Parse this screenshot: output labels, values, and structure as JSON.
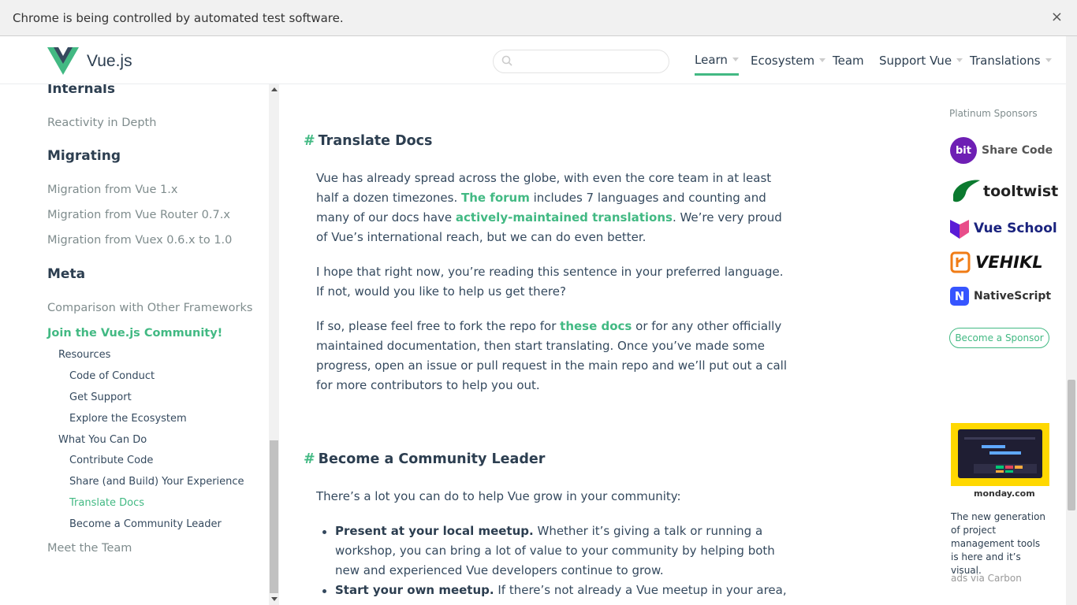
{
  "banner": {
    "text": "Chrome is being controlled by automated test software.",
    "close": "×"
  },
  "header": {
    "brand": "Vue.js",
    "search_placeholder": "",
    "nav": [
      "Learn",
      "Ecosystem",
      "Team",
      "Support Vue",
      "Translations"
    ]
  },
  "sidebar": {
    "internals": "Internals",
    "reactivity": "Reactivity in Depth",
    "migrating": "Migrating",
    "mig1": "Migration from Vue 1.x",
    "mig2": "Migration from Vue Router 0.7.x",
    "mig3": "Migration from Vuex 0.6.x to 1.0",
    "meta": "Meta",
    "comparison": "Comparison with Other Frameworks",
    "join": "Join the Vue.js Community!",
    "resources": "Resources",
    "coc": "Code of Conduct",
    "support": "Get Support",
    "explore": "Explore the Ecosystem",
    "whatyoucando": "What You Can Do",
    "contribute": "Contribute Code",
    "share": "Share (and Build) Your Experience",
    "translate": "Translate Docs",
    "leader": "Become a Community Leader",
    "team": "Meet the Team"
  },
  "content": {
    "hash": "#",
    "h_translate": "Translate Docs",
    "p1": {
      "a": "Vue has already spread across the globe, with even the core team in at least half a dozen timezones. ",
      "link1": "The forum",
      "b": " includes 7 languages and counting and many of our docs have ",
      "link2": "actively-maintained translations",
      "c": ". We’re very proud of Vue’s international reach, but we can do even better."
    },
    "p2": "I hope that right now, you’re reading this sentence in your preferred language. If not, would you like to help us get there?",
    "p3": {
      "a": "If so, please feel free to fork the repo for ",
      "link": "these docs",
      "b": " or for any other officially maintained documentation, then start translating. Once you’ve made some progress, open an issue or pull request in the main repo and we’ll put out a call for more contributors to help you out."
    },
    "h_leader": "Become a Community Leader",
    "p4": "There’s a lot you can do to help Vue grow in your community:",
    "li1": {
      "b": "Present at your local meetup.",
      "t": " Whether it’s giving a talk or running a workshop, you can bring a lot of value to your community by helping both new and experienced Vue developers continue to grow."
    },
    "li2": {
      "b": "Start your own meetup.",
      "t": " If there’s not already a Vue meetup in your area, you can start"
    }
  },
  "sponsors": {
    "title": "Platinum Sponsors",
    "items": [
      {
        "icon": "bit",
        "name": "Share Code",
        "color": "#6e1fb4"
      },
      {
        "icon": "",
        "name": "tooltwist",
        "color": "#0b7a2f"
      },
      {
        "icon": "",
        "name": "Vue School",
        "color": "#5a1bd6"
      },
      {
        "icon": "",
        "name": "VEHIKL",
        "color": "#111111"
      },
      {
        "icon": "N",
        "name": "NativeScript",
        "color": "#3655ff"
      }
    ],
    "become": "Become a Sponsor"
  },
  "ad": {
    "brand": "monday.com",
    "text": "The new generation of project management tools is here and it’s visual.",
    "via": "ads via Carbon"
  },
  "colors": {
    "accent": "#42b983",
    "text": "#2c3e50"
  }
}
